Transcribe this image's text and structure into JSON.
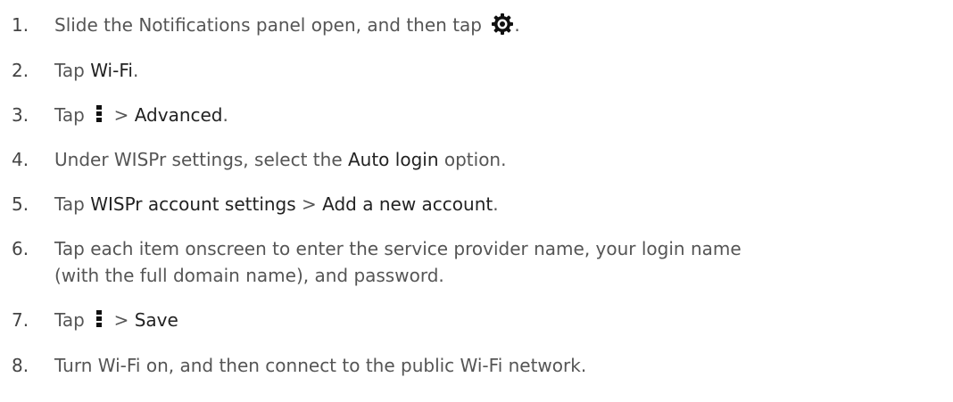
{
  "steps": [
    {
      "number": "1.",
      "pre": "Slide the Notifications panel open, and then tap ",
      "icon": "gear-icon",
      "post": "."
    },
    {
      "number": "2.",
      "pre": "Tap ",
      "bold": "Wi-Fi",
      "post": "."
    },
    {
      "number": "3.",
      "pre": "Tap ",
      "icon": "overflow-menu-icon",
      "mid": " > ",
      "bold": "Advanced",
      "post": "."
    },
    {
      "number": "4.",
      "pre": "Under WISPr settings, select the ",
      "bold": "Auto login",
      "post": " option."
    },
    {
      "number": "5.",
      "pre": "Tap ",
      "bold": "WISPr account settings",
      "mid": " > ",
      "bold2": "Add a new account",
      "post": "."
    },
    {
      "number": "6.",
      "line1": "Tap each item onscreen to enter the service provider name, your login name",
      "line2": "(with the full domain name), and password."
    },
    {
      "number": "7.",
      "pre": "Tap ",
      "icon": "overflow-menu-icon",
      "mid": " > ",
      "bold": "Save"
    },
    {
      "number": "8.",
      "pre": "Turn Wi-Fi on, and then connect to the public Wi-Fi network."
    }
  ],
  "colors": {
    "text": "#555555",
    "emphasis": "#222222",
    "icon": "#111111"
  }
}
